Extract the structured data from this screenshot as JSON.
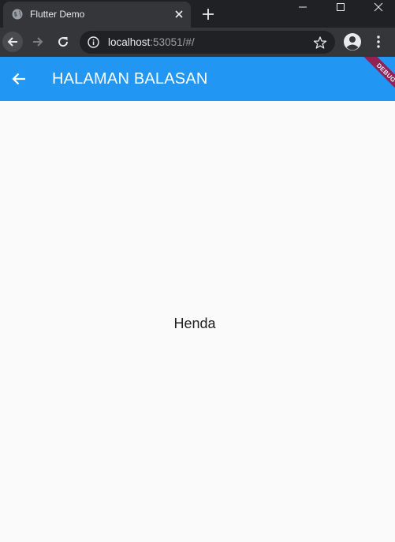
{
  "browser": {
    "tab_title": "Flutter Demo",
    "url_host": "localhost",
    "url_rest": ":53051/#/",
    "icons": {
      "favicon": "globe-icon",
      "tab_close": "close-icon",
      "new_tab": "plus-icon",
      "minimize": "minimize-icon",
      "maximize": "maximize-icon",
      "close_window": "close-window-icon",
      "back": "arrow-left-icon",
      "forward": "arrow-right-icon",
      "reload": "reload-icon",
      "site_info": "info-icon",
      "bookmark": "star-icon",
      "profile": "account-icon",
      "menu": "more-vert-icon"
    }
  },
  "app": {
    "appbar_title": "HALAMAN BALASAN",
    "debug_banner": "DEBUG",
    "body_text": "Henda",
    "colors": {
      "appbar": "#2196f3",
      "debug_banner": "#a50e37",
      "background": "#fafafa"
    }
  }
}
